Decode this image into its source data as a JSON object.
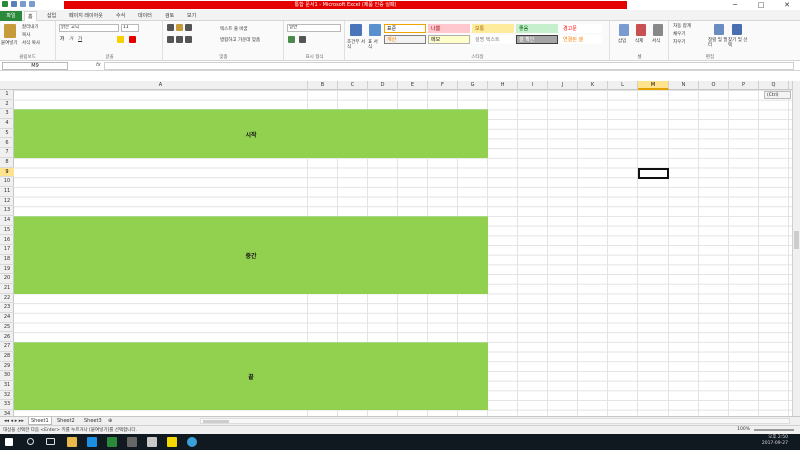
{
  "window": {
    "title": "통합 문서1 - Microsoft Excel (제품 인증 실패)",
    "controls": [
      "─",
      "□",
      "✕"
    ]
  },
  "tabs": [
    "파일",
    "홈",
    "삽입",
    "페이지 레이아웃",
    "수식",
    "데이터",
    "검토",
    "보기"
  ],
  "ribbon": {
    "clipboard": {
      "paste": "붙여넣기",
      "cut": "잘라내기",
      "copy": "복사",
      "format_painter": "서식 복사",
      "label": "클립보드"
    },
    "font": {
      "name": "맑은 고딕",
      "size": "11",
      "bold": "가",
      "italic": "가",
      "underline": "가",
      "label": "글꼴"
    },
    "alignment": {
      "wrap": "텍스트 줄 바꿈",
      "merge": "병합하고 가운데 맞춤",
      "label": "맞춤"
    },
    "number": {
      "format": "일반",
      "label": "표시 형식"
    },
    "styles": {
      "conditional": "조건부 서식",
      "table": "표 서식",
      "cells": [
        {
          "label": "표준",
          "bg": "#ffffff",
          "fg": "#222222",
          "border": "#f0a400"
        },
        {
          "label": "나쁨",
          "bg": "#ffc7ce",
          "fg": "#9c0006",
          "border": "#ffc7ce"
        },
        {
          "label": "보통",
          "bg": "#ffeb9c",
          "fg": "#9c6500",
          "border": "#ffeb9c"
        },
        {
          "label": "좋음",
          "bg": "#c6efce",
          "fg": "#006100",
          "border": "#c6efce"
        },
        {
          "label": "경고문",
          "bg": "#ffffff",
          "fg": "#ff0000",
          "border": "#ffffff"
        },
        {
          "label": "계산",
          "bg": "#f2f2f2",
          "fg": "#fa7d00",
          "border": "#7f7f7f"
        },
        {
          "label": "메모",
          "bg": "#ffffcc",
          "fg": "#222222",
          "border": "#b2b2b2"
        },
        {
          "label": "설명 텍스트",
          "bg": "#ffffff",
          "fg": "#7f7f7f",
          "border": "#ffffff"
        },
        {
          "label": "셀 확인",
          "bg": "#a5a5a5",
          "fg": "#ffffff",
          "border": "#3f3f3f"
        },
        {
          "label": "연결된 셀",
          "bg": "#ffffff",
          "fg": "#fa7d00",
          "border": "#ffffff"
        }
      ],
      "label": "스타일"
    },
    "cells": {
      "insert": "삽입",
      "delete": "삭제",
      "format": "서식",
      "label": "셀"
    },
    "editing": {
      "autosum": "자동 합계",
      "fill": "채우기",
      "clear": "지우기",
      "sort": "정렬 및 필터",
      "find": "찾기 및 선택",
      "label": "편집"
    }
  },
  "formula_bar": {
    "name_box": "M9",
    "fx": "fx",
    "value": ""
  },
  "columns": [
    "A",
    "B",
    "C",
    "D",
    "E",
    "F",
    "G",
    "H",
    "I",
    "J",
    "K",
    "L",
    "M",
    "N",
    "O",
    "P",
    "Q"
  ],
  "selected_column": "M",
  "selected_row": "9",
  "rows": [
    "1",
    "2",
    "3",
    "4",
    "5",
    "6",
    "7",
    "8",
    "9",
    "10",
    "11",
    "12",
    "13",
    "14",
    "15",
    "16",
    "17",
    "18",
    "19",
    "20",
    "21",
    "22",
    "23",
    "24",
    "25",
    "26",
    "27",
    "28",
    "29",
    "30",
    "31",
    "32",
    "33",
    "34"
  ],
  "blocks": [
    {
      "text": "시작",
      "fill": "#92d050"
    },
    {
      "text": "중간",
      "fill": "#92d050"
    },
    {
      "text": "끝",
      "fill": "#92d050"
    }
  ],
  "paste_options": "(Ctrl)",
  "sheets": [
    "Sheet1",
    "Sheet2",
    "Sheet3"
  ],
  "active_sheet": "Sheet1",
  "status": {
    "message": "대상을 선택한 다음 <Enter> 키를 누르거나 [붙여넣기]를 선택합니다.",
    "zoom": "100%"
  },
  "clock": {
    "time": "오후 2:50",
    "date": "2017-09-27"
  }
}
